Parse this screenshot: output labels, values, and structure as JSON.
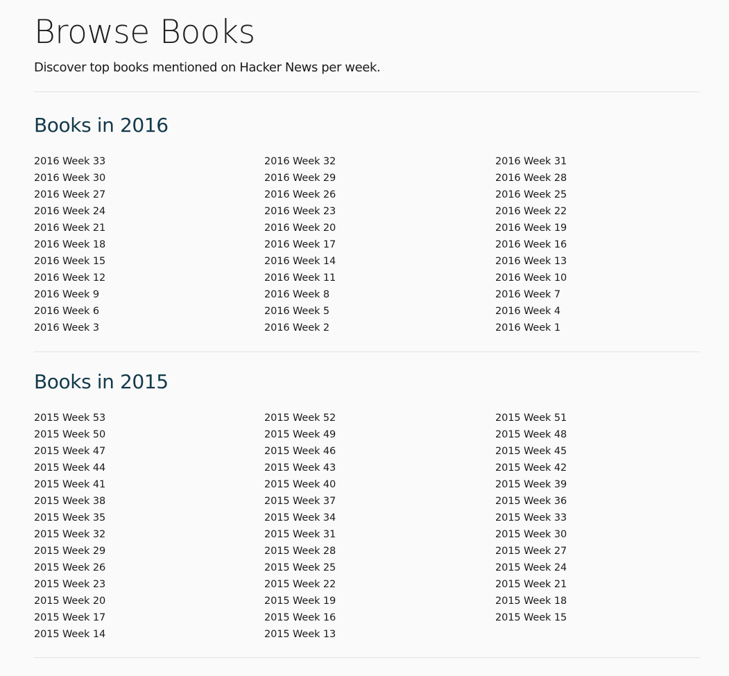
{
  "header": {
    "title": "Browse Books",
    "subtitle": "Discover top books mentioned on Hacker News per week."
  },
  "sections": [
    {
      "title": "Books in 2016",
      "links": [
        "2016 Week 33",
        "2016 Week 32",
        "2016 Week 31",
        "2016 Week 30",
        "2016 Week 29",
        "2016 Week 28",
        "2016 Week 27",
        "2016 Week 26",
        "2016 Week 25",
        "2016 Week 24",
        "2016 Week 23",
        "2016 Week 22",
        "2016 Week 21",
        "2016 Week 20",
        "2016 Week 19",
        "2016 Week 18",
        "2016 Week 17",
        "2016 Week 16",
        "2016 Week 15",
        "2016 Week 14",
        "2016 Week 13",
        "2016 Week 12",
        "2016 Week 11",
        "2016 Week 10",
        "2016 Week 9",
        "2016 Week 8",
        "2016 Week 7",
        "2016 Week 6",
        "2016 Week 5",
        "2016 Week 4",
        "2016 Week 3",
        "2016 Week 2",
        "2016 Week 1"
      ]
    },
    {
      "title": "Books in 2015",
      "links": [
        "2015 Week 53",
        "2015 Week 52",
        "2015 Week 51",
        "2015 Week 50",
        "2015 Week 49",
        "2015 Week 48",
        "2015 Week 47",
        "2015 Week 46",
        "2015 Week 45",
        "2015 Week 44",
        "2015 Week 43",
        "2015 Week 42",
        "2015 Week 41",
        "2015 Week 40",
        "2015 Week 39",
        "2015 Week 38",
        "2015 Week 37",
        "2015 Week 36",
        "2015 Week 35",
        "2015 Week 34",
        "2015 Week 33",
        "2015 Week 32",
        "2015 Week 31",
        "2015 Week 30",
        "2015 Week 29",
        "2015 Week 28",
        "2015 Week 27",
        "2015 Week 26",
        "2015 Week 25",
        "2015 Week 24",
        "2015 Week 23",
        "2015 Week 22",
        "2015 Week 21",
        "2015 Week 20",
        "2015 Week 19",
        "2015 Week 18",
        "2015 Week 17",
        "2015 Week 16",
        "2015 Week 15",
        "2015 Week 14",
        "2015 Week 13"
      ]
    }
  ]
}
